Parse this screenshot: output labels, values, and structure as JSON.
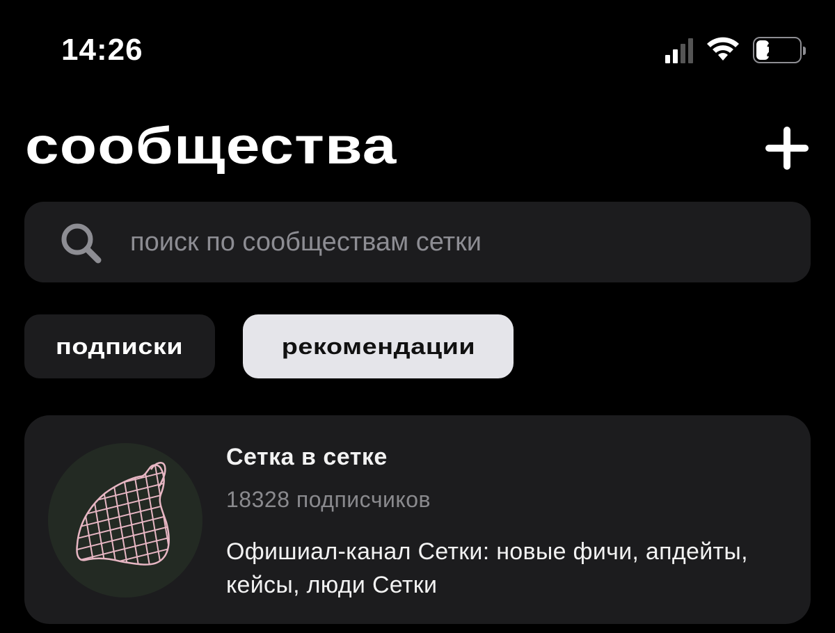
{
  "status_bar": {
    "time": "14:26",
    "battery_level": "24",
    "icons": [
      "cellular-signal-icon",
      "wifi-icon",
      "battery-icon"
    ]
  },
  "header": {
    "title": "сообщества",
    "add_icon": "plus-icon"
  },
  "search": {
    "placeholder": "поиск по сообществам сетки",
    "value": "",
    "icon": "search-icon"
  },
  "tabs": [
    {
      "label": "подписки",
      "selected": false
    },
    {
      "label": "рекомендации",
      "selected": true
    }
  ],
  "communities": [
    {
      "title": "Сетка в сетке",
      "subscribers": "18328 подписчиков",
      "description": "Офишиал-канал Сетки: новые фичи, апдейты, кейсы, люди Сетки",
      "avatar": "mesh-bag-icon"
    }
  ],
  "colors": {
    "background": "#000000",
    "surface": "#1c1c1e",
    "selected_tab": "#e5e5ea",
    "secondary_text": "#8a8a8e",
    "avatar_bg": "#232a23",
    "avatar_stroke": "#e8b7c4"
  }
}
